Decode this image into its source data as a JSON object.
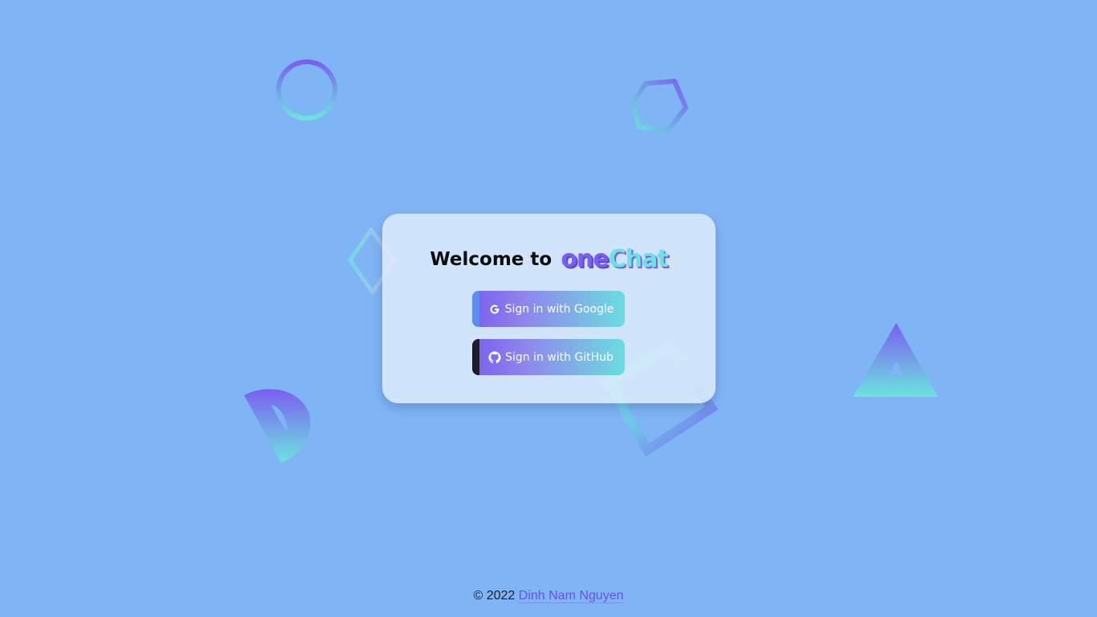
{
  "login_card": {
    "welcome_text": "Welcome to",
    "brand_part1": "one",
    "brand_part2": "Chat",
    "google_button_label": "Sign in with Google",
    "github_button_label": "Sign in with GitHub"
  },
  "footer": {
    "copyright": "© 2022",
    "author": "Dinh Nam Nguyen"
  },
  "colors": {
    "background": "#80b5f5",
    "gradient_start": "#7a5ef0",
    "gradient_end": "#6ce3de",
    "google_accent": "#5f8cf0",
    "github_accent": "#1c1c28",
    "link": "#6a4fe6"
  },
  "icons": {
    "google": "google-icon",
    "github": "github-icon"
  }
}
